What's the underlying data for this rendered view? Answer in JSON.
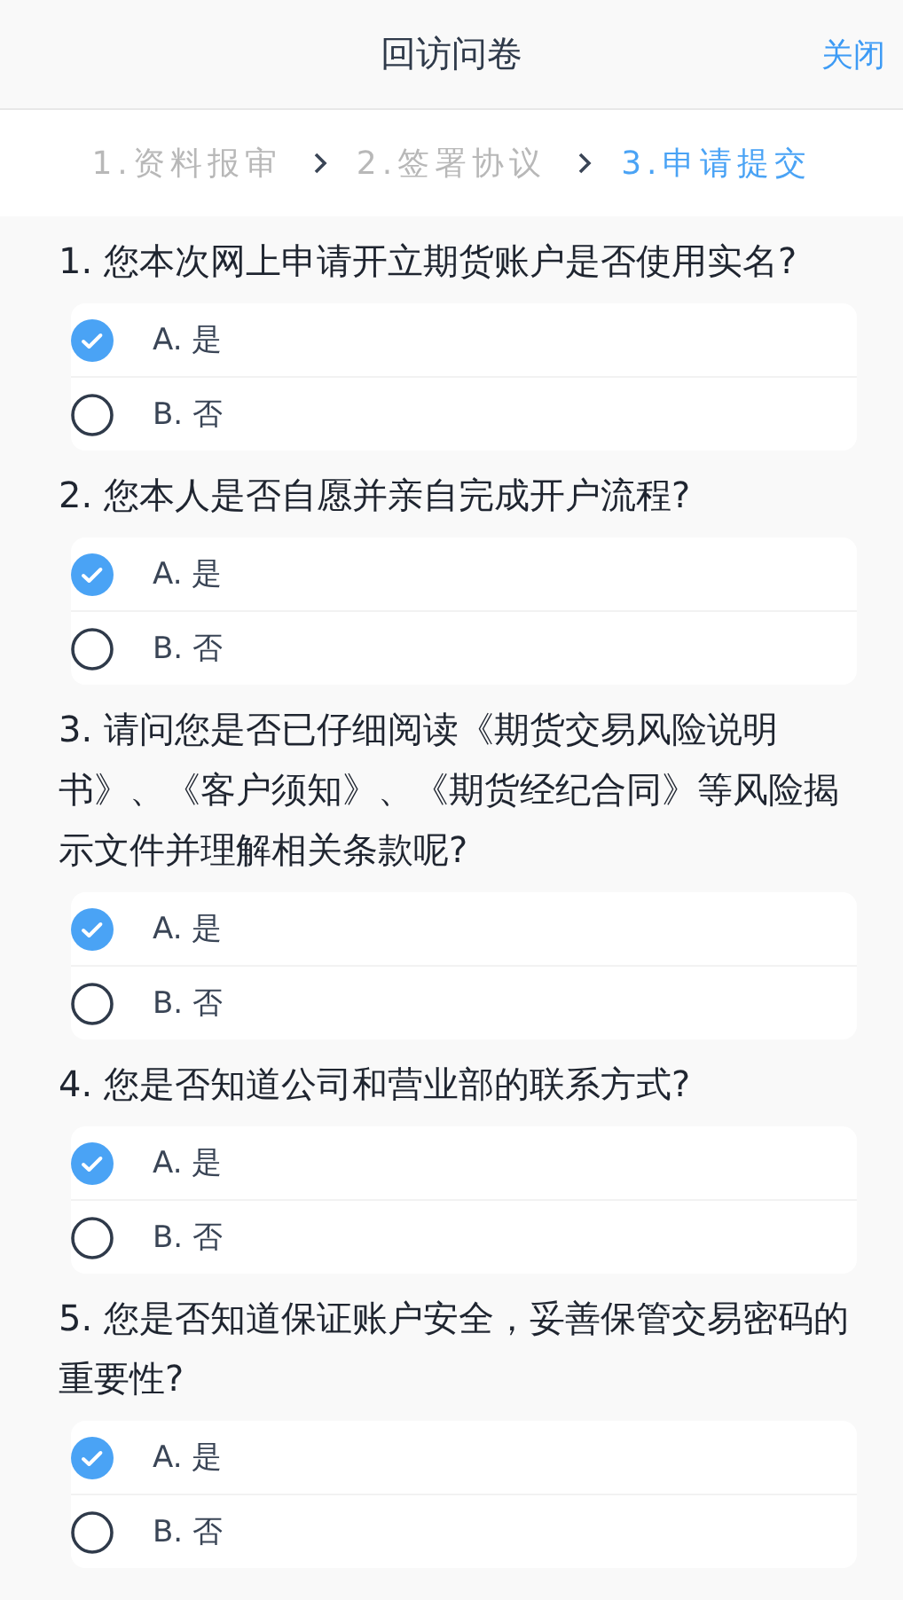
{
  "header": {
    "title": "回访问卷",
    "close": "关闭"
  },
  "steps": [
    {
      "label": "1.资料报审",
      "selected": false
    },
    {
      "label": "2.签署协议",
      "selected": false
    },
    {
      "label": "3.申请提交",
      "selected": true
    }
  ],
  "questions": [
    {
      "text": "1. 您本次网上申请开立期货账户是否使用实名?",
      "options": [
        {
          "label": "A. 是",
          "selected": true
        },
        {
          "label": "B. 否",
          "selected": false
        }
      ]
    },
    {
      "text": "2. 您本人是否自愿并亲自完成开户流程?",
      "options": [
        {
          "label": "A. 是",
          "selected": true
        },
        {
          "label": "B. 否",
          "selected": false
        }
      ]
    },
    {
      "text": "3. 请问您是否已仔细阅读《期货交易风险说明书》、《客户须知》、《期货经纪合同》等风险揭示文件并理解相关条款呢?",
      "options": [
        {
          "label": "A. 是",
          "selected": true
        },
        {
          "label": "B. 否",
          "selected": false
        }
      ]
    },
    {
      "text": "4. 您是否知道公司和营业部的联系方式?",
      "options": [
        {
          "label": "A. 是",
          "selected": true
        },
        {
          "label": "B. 否",
          "selected": false
        }
      ]
    },
    {
      "text": "5. 您是否知道保证账户安全，妥善保管交易密码的重要性?",
      "options": [
        {
          "label": "A. 是",
          "selected": true
        },
        {
          "label": "B. 否",
          "selected": false
        }
      ]
    }
  ]
}
